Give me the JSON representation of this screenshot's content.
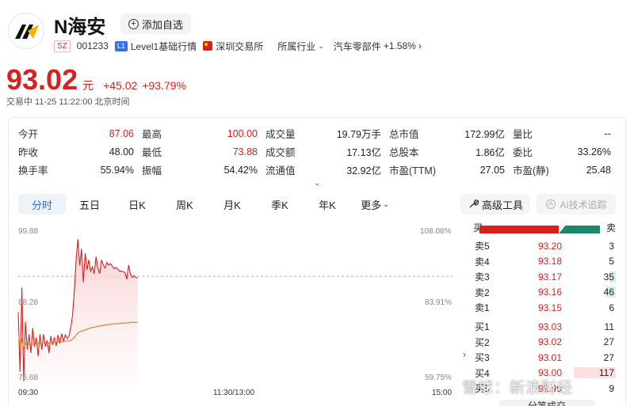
{
  "header": {
    "name": "N海安",
    "watch_label": "添加自选",
    "exchange_badge": "SZ",
    "code": "001233",
    "level_badge": "L1",
    "level_text": "Level1基础行情",
    "exchange_name": "深圳交易所",
    "industry_label": "所属行业",
    "industry_name": "汽车零部件",
    "industry_change": "+1.58%"
  },
  "quote": {
    "price": "93.02",
    "unit": "元",
    "change": "+45.02",
    "change_pct": "+93.79%",
    "status": "交易中 11-25 11:22:00 北京时间"
  },
  "stats": [
    [
      [
        "今开",
        "87.06",
        "red"
      ],
      [
        "最高",
        "100.00",
        "red"
      ],
      [
        "成交量",
        "19.79万手",
        ""
      ],
      [
        "总市值",
        "172.99亿",
        ""
      ],
      [
        "量比",
        "--",
        ""
      ]
    ],
    [
      [
        "昨收",
        "48.00",
        ""
      ],
      [
        "最低",
        "73.88",
        "red"
      ],
      [
        "成交额",
        "17.13亿",
        ""
      ],
      [
        "总股本",
        "1.86亿",
        ""
      ],
      [
        "委比",
        "33.26%",
        ""
      ]
    ],
    [
      [
        "换手率",
        "55.94%",
        ""
      ],
      [
        "振幅",
        "54.42%",
        ""
      ],
      [
        "流通值",
        "32.92亿",
        ""
      ],
      [
        "市盈(TTM)",
        "27.05",
        ""
      ],
      [
        "市盈(静)",
        "25.48",
        ""
      ]
    ]
  ],
  "tabs": [
    "分时",
    "五日",
    "日K",
    "周K",
    "月K",
    "季K",
    "年K",
    "更多"
  ],
  "tools": {
    "advanced": "高级工具",
    "ai": "AI技术追踪"
  },
  "chart_data": {
    "type": "line",
    "y_left_ticks": [
      "99.88",
      "88.28",
      "76.68"
    ],
    "y_right_ticks": [
      "108.08%",
      "83.91%",
      "59.75%"
    ],
    "x_ticks": [
      "09:30",
      "11:30/13:00",
      "15:00"
    ],
    "prev_close": 48.0,
    "ylim": [
      76.68,
      99.88
    ],
    "series": [
      {
        "values": [
          88.0,
          78.5,
          92.0,
          77.0,
          86.5,
          82.0,
          84.5,
          81.5,
          85.5,
          82.5,
          84.0,
          81.0,
          84.5,
          82.0,
          84.5,
          82.5,
          83.5,
          81.5,
          84.2,
          82.8,
          84.0,
          82.6,
          84.4,
          83.0,
          84.6,
          83.4,
          84.4,
          83.8,
          84.2,
          85.5,
          87.5,
          91.5,
          96.5,
          99.7,
          95.5,
          98.2,
          92.8,
          97.5,
          94.8,
          96.4,
          94.6,
          95.3,
          94.2,
          96.9,
          95.1,
          94.2,
          96.4,
          95.6,
          95.1,
          96.0,
          95.6,
          95.8,
          95.4,
          95.0,
          95.2,
          94.9,
          94.6,
          94.6,
          94.5,
          94.4,
          93.3,
          95.6,
          94.1,
          93.6,
          93.9,
          93.6,
          93.5
        ]
      },
      {
        "values": [
          85.5,
          82.0,
          83.8,
          82.2,
          83.0,
          82.7,
          82.9,
          82.8,
          82.9,
          82.9,
          83.0,
          82.9,
          83.0,
          83.0,
          83.1,
          83.0,
          83.1,
          83.1,
          83.2,
          83.2,
          83.2,
          83.2,
          83.3,
          83.3,
          83.3,
          83.3,
          83.4,
          83.4,
          83.4,
          83.5,
          83.7,
          84.0,
          84.4,
          84.7,
          84.9,
          85.0,
          85.1,
          85.2,
          85.3,
          85.4,
          85.5,
          85.6,
          85.6,
          85.7,
          85.8,
          85.8,
          85.9,
          85.9,
          86.0,
          86.0,
          86.1,
          86.1,
          86.1,
          86.2,
          86.2,
          86.2,
          86.2,
          86.3,
          86.3,
          86.3,
          86.3,
          86.3,
          86.4,
          86.4,
          86.4,
          86.4,
          86.4
        ]
      }
    ]
  },
  "orderbook": {
    "buy_label": "买",
    "sell_label": "卖",
    "buy_ratio": 0.66,
    "rows": [
      {
        "level": "卖5",
        "price": "93.20",
        "qty": "3",
        "bar": 0.0,
        "color": "#d7f0e8"
      },
      {
        "level": "卖4",
        "price": "93.18",
        "qty": "5",
        "bar": 0.0,
        "color": "#d7f0e8"
      },
      {
        "level": "卖3",
        "price": "93.17",
        "qty": "35",
        "bar": 0.12,
        "color": "#d7f0e8"
      },
      {
        "level": "卖2",
        "price": "93.16",
        "qty": "46",
        "bar": 0.18,
        "color": "#d7f0e8"
      },
      {
        "level": "卖1",
        "price": "93.15",
        "qty": "6",
        "bar": 0.0,
        "color": "#d7f0e8"
      },
      {
        "level": "买1",
        "price": "93.03",
        "qty": "11",
        "bar": 0.0,
        "color": "#fbe0e2"
      },
      {
        "level": "买2",
        "price": "93.02",
        "qty": "27",
        "bar": 0.0,
        "color": "#fbe0e2"
      },
      {
        "level": "买3",
        "price": "93.01",
        "qty": "27",
        "bar": 0.0,
        "color": "#fbe0e2"
      },
      {
        "level": "买4",
        "price": "93.00",
        "qty": "117",
        "bar": 0.78,
        "color": "#fbe0e2"
      },
      {
        "level": "买5",
        "price": "92.99",
        "qty": "9",
        "bar": 0.0,
        "color": "#fbe0e2"
      }
    ]
  },
  "time_sales": "分笔成交",
  "watermark": "雪球：新浪财经",
  "colors": {
    "up": "#d9201f",
    "down": "#1a8a6e",
    "avg": "#e07a1f",
    "accent": "#2f6cd4"
  }
}
